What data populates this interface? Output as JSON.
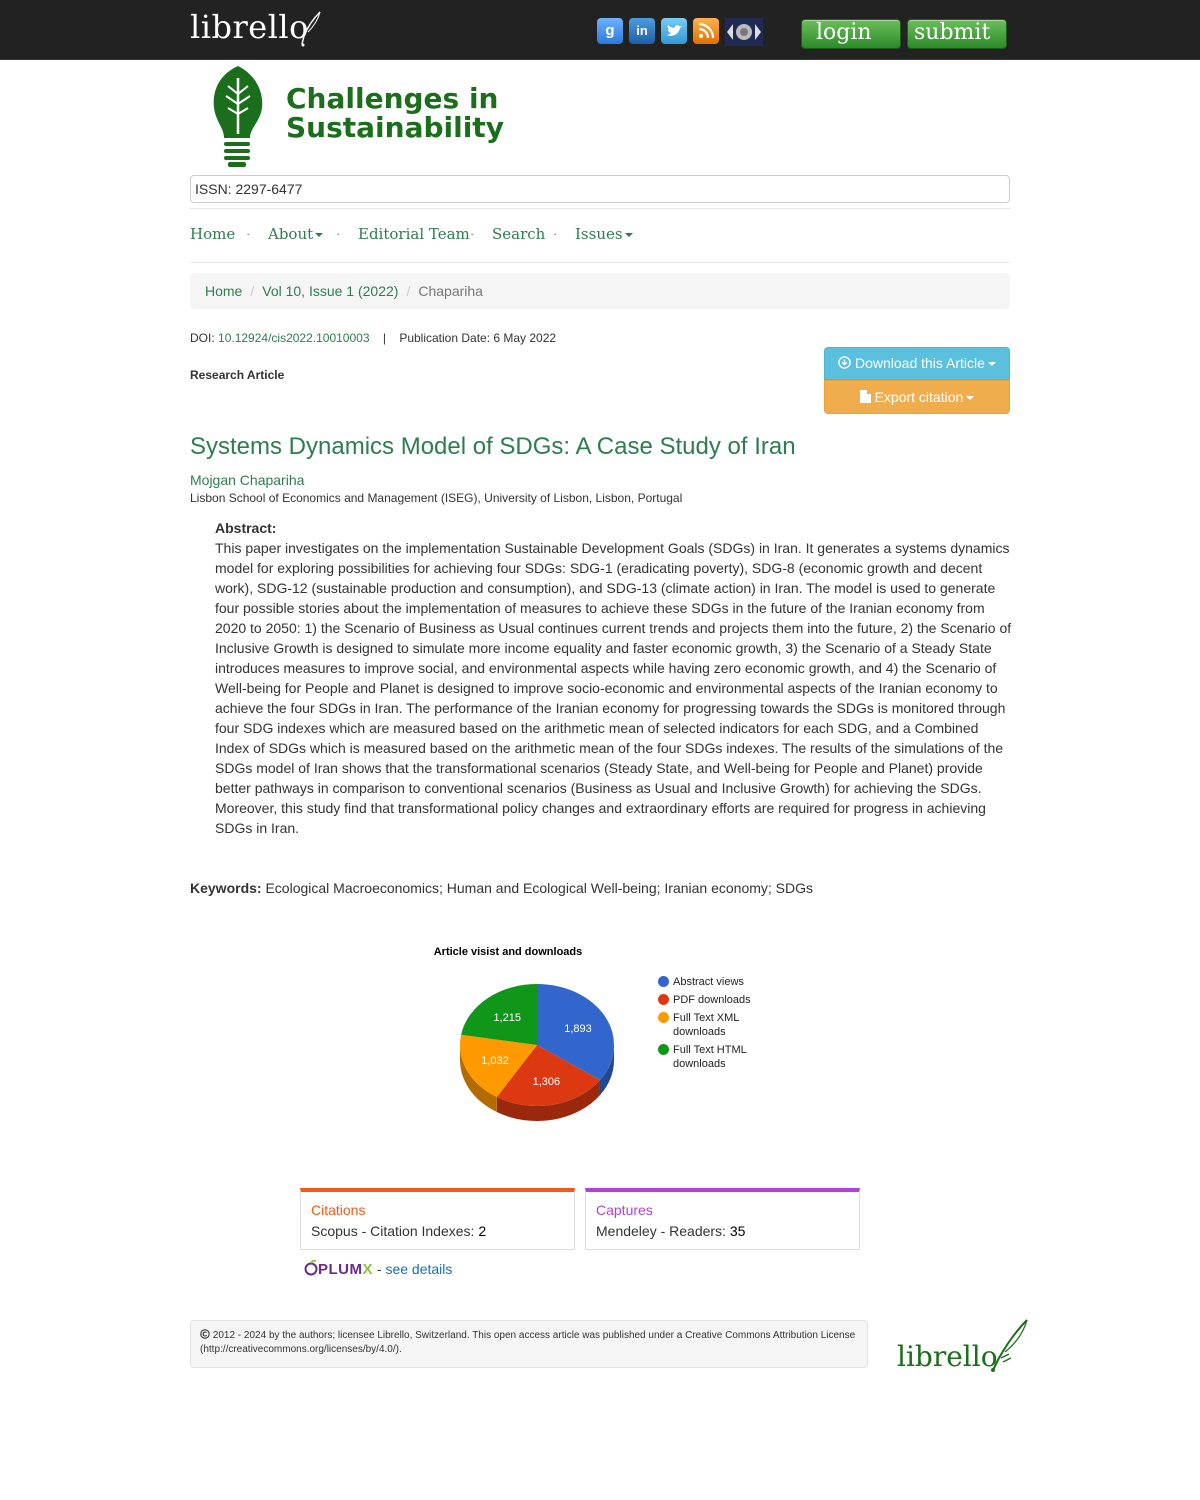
{
  "header": {
    "brand": "librello",
    "social": [
      {
        "name": "google-plus-icon",
        "glyph": "g"
      },
      {
        "name": "linkedin-icon",
        "glyph": "in"
      },
      {
        "name": "twitter-icon",
        "glyph": "t"
      },
      {
        "name": "rss-icon",
        "glyph": ")"
      }
    ],
    "login_label": "login",
    "submit_label": "submit"
  },
  "journal": {
    "title_line1": "Challenges in",
    "title_line2": "Sustainability",
    "issn": "ISSN: 2297-6477"
  },
  "nav": {
    "home": "Home",
    "about": "About",
    "editorial": "Editorial Team",
    "search": "Search",
    "issues": "Issues"
  },
  "breadcrumb": {
    "home": "Home",
    "issue": "Vol 10, Issue 1 (2022)",
    "current": "Chapariha"
  },
  "article": {
    "doi_label": "DOI:",
    "doi": "10.12924/cis2022.10010003",
    "pub_date": "Publication Date: 6 May 2022",
    "type": "Research Article",
    "download_label": "Download this Article",
    "export_label": "Export citation",
    "title": "Systems Dynamics Model of SDGs: A Case Study of Iran",
    "author": "Mojgan Chapariha",
    "affiliation": "Lisbon School of Economics and Management (ISEG), University of Lisbon, Lisbon, Portugal",
    "abstract_label": "Abstract:",
    "abstract": "This paper investigates on the implementation Sustainable Development Goals (SDGs) in Iran. It generates a systems dynamics model for exploring possibilities for achieving four SDGs: SDG-1 (eradicating poverty), SDG-8 (economic growth and decent work), SDG-12 (sustainable production and consumption), and SDG-13 (climate action) in Iran. The model is used to generate four possible stories about the implementation of measures to achieve these SDGs in the future of the Iranian economy from 2020 to 2050: 1) the Scenario of Business as Usual continues current trends and projects them into the future, 2) the Scenario of Inclusive Growth is designed to simulate more income equality and faster economic growth, 3) the Scenario of a Steady State introduces measures to improve social, and environmental aspects while having zero economic growth, and 4) the Scenario of Well-being for People and Planet is designed to improve socio-economic and environmental aspects of the Iranian economy to achieve the four SDGs in Iran. The performance of the Iranian economy for progressing towards the SDGs is monitored through four SDG indexes which are measured based on the arithmetic mean of selected indicators for each SDG, and a Combined Index of SDGs which is measured based on the arithmetic mean of the four SDGs indexes. The results of the simulations of the SDGs model of Iran shows that the transformational scenarios (Steady State, and Well-being for People and Planet) provide better pathways in comparison to conventional scenarios (Business as Usual and Inclusive Growth) for achieving the SDGs. Moreover, this study find that transformational policy changes and extraordinary efforts are required for progress in achieving SDGs in Iran.",
    "keywords_label": "Keywords:",
    "keywords": "Ecological Macroeconomics; Human and Ecological Well-being; Iranian economy; SDGs"
  },
  "chart_data": {
    "type": "pie",
    "title": "Article visist and downloads",
    "series": [
      {
        "name": "Abstract views",
        "value": 1893,
        "label": "1,893",
        "color": "#3366cc"
      },
      {
        "name": "PDF downloads",
        "value": 1306,
        "label": "1,306",
        "color": "#dc3912"
      },
      {
        "name": "Full Text XML downloads",
        "value": 1032,
        "label": "1,032",
        "color": "#ff9900"
      },
      {
        "name": "Full Text HTML downloads",
        "value": 1215,
        "label": "1,215",
        "color": "#109618"
      }
    ],
    "legend_position": "right"
  },
  "metrics": {
    "citations_head": "Citations",
    "citations_line": "Scopus - Citation Indexes:",
    "citations_value": "2",
    "captures_head": "Captures",
    "captures_line": "Mendeley - Readers:",
    "captures_value": "35",
    "plumx_logo_a": "PLUM",
    "plumx_logo_b": "X",
    "plumx_link": "see details"
  },
  "footer": {
    "license": "2012 - 2024 by the authors; licensee Librello, Switzerland. This open access article was published under a Creative Commons Attribution License (http://creativecommons.org/licenses/by/4.0/).",
    "brand": "librello"
  }
}
